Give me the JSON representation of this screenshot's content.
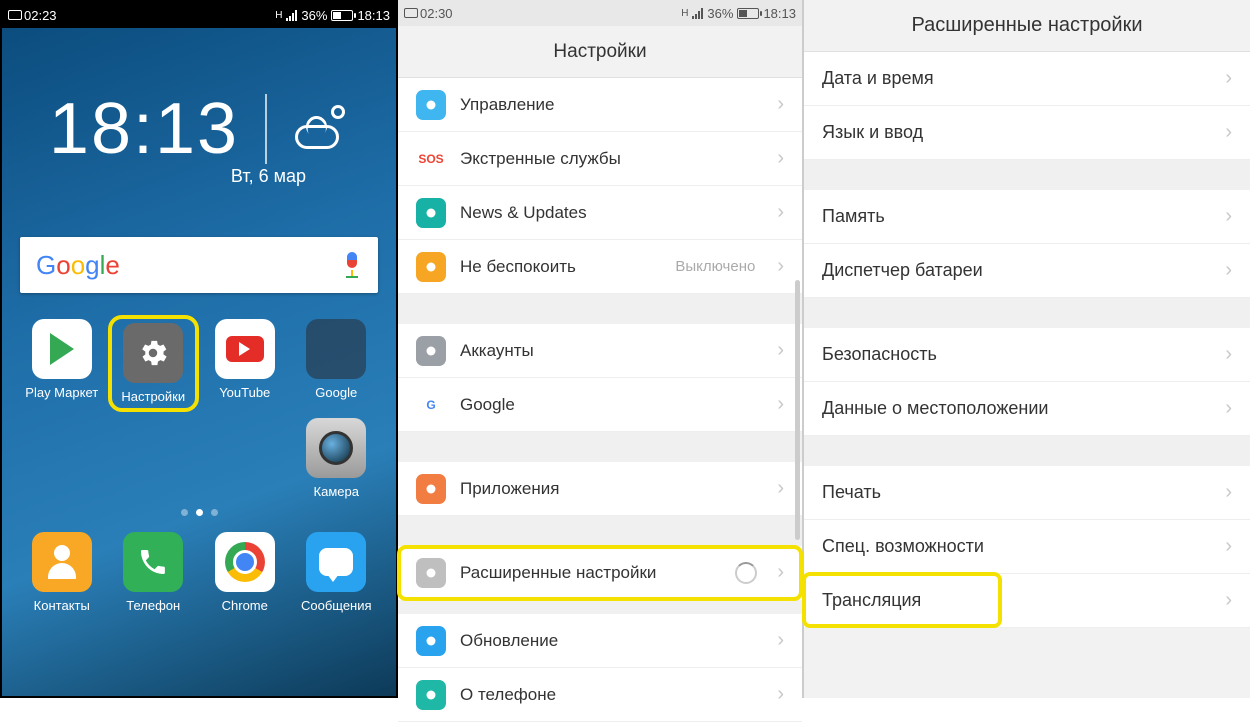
{
  "pane1": {
    "status": {
      "rec_time": "02:23",
      "signal_label": "H",
      "battery": "36%",
      "time": "18:13"
    },
    "clock_time": "18:13",
    "date": "Вт, 6 мар",
    "search_logo": "Google",
    "apps": [
      {
        "label": "Play Маркет"
      },
      {
        "label": "Настройки",
        "highlighted": true
      },
      {
        "label": "YouTube"
      },
      {
        "label": "Google"
      }
    ],
    "camera_label": "Камера",
    "dock": [
      {
        "label": "Контакты"
      },
      {
        "label": "Телефон"
      },
      {
        "label": "Chrome"
      },
      {
        "label": "Сообщения"
      }
    ]
  },
  "pane2": {
    "status": {
      "rec_time": "02:30",
      "signal_label": "H",
      "battery": "36%",
      "time": "18:13"
    },
    "title": "Настройки",
    "rows": [
      {
        "icon": "hand-icon",
        "icon_bg": "#3fb6ef",
        "label": "Управление"
      },
      {
        "icon": "sos-icon",
        "icon_bg": "#fff",
        "label": "Экстренные службы",
        "icon_text": "SOS",
        "icon_fg": "#e43"
      },
      {
        "icon": "news-icon",
        "icon_bg": "#17b1a6",
        "label": "News & Updates"
      },
      {
        "icon": "dnd-icon",
        "icon_bg": "#f6a623",
        "label": "Не беспокоить",
        "value": "Выключено"
      },
      {
        "gap": true
      },
      {
        "icon": "account-icon",
        "icon_bg": "#9aa0a6",
        "label": "Аккаунты"
      },
      {
        "icon": "google-g-icon",
        "icon_bg": "#fff",
        "label": "Google",
        "icon_text": "G",
        "icon_fg": "#4285f4"
      },
      {
        "gap": true
      },
      {
        "icon": "apps-icon",
        "icon_bg": "#f27d42",
        "label": "Приложения"
      },
      {
        "gap": true
      },
      {
        "icon": "advanced-icon",
        "icon_bg": "#bfbfbf",
        "label": "Расширенные настройки",
        "highlighted": true,
        "spinner": true
      },
      {
        "gap_small": true
      },
      {
        "icon": "update-icon",
        "icon_bg": "#2aa3ef",
        "label": "Обновление"
      },
      {
        "icon": "phone-info-icon",
        "icon_bg": "#1fb7a6",
        "label": "О телефоне"
      }
    ]
  },
  "pane3": {
    "title": "Расширенные настройки",
    "rows": [
      {
        "label": "Дата и время"
      },
      {
        "label": "Язык и ввод"
      },
      {
        "gap": true
      },
      {
        "label": "Память"
      },
      {
        "label": "Диспетчер батареи"
      },
      {
        "gap": true
      },
      {
        "label": "Безопасность"
      },
      {
        "label": "Данные о местоположении"
      },
      {
        "gap": true
      },
      {
        "label": "Печать"
      },
      {
        "label": "Спец. возможности"
      },
      {
        "label": "Трансляция",
        "highlighted": true
      }
    ]
  }
}
